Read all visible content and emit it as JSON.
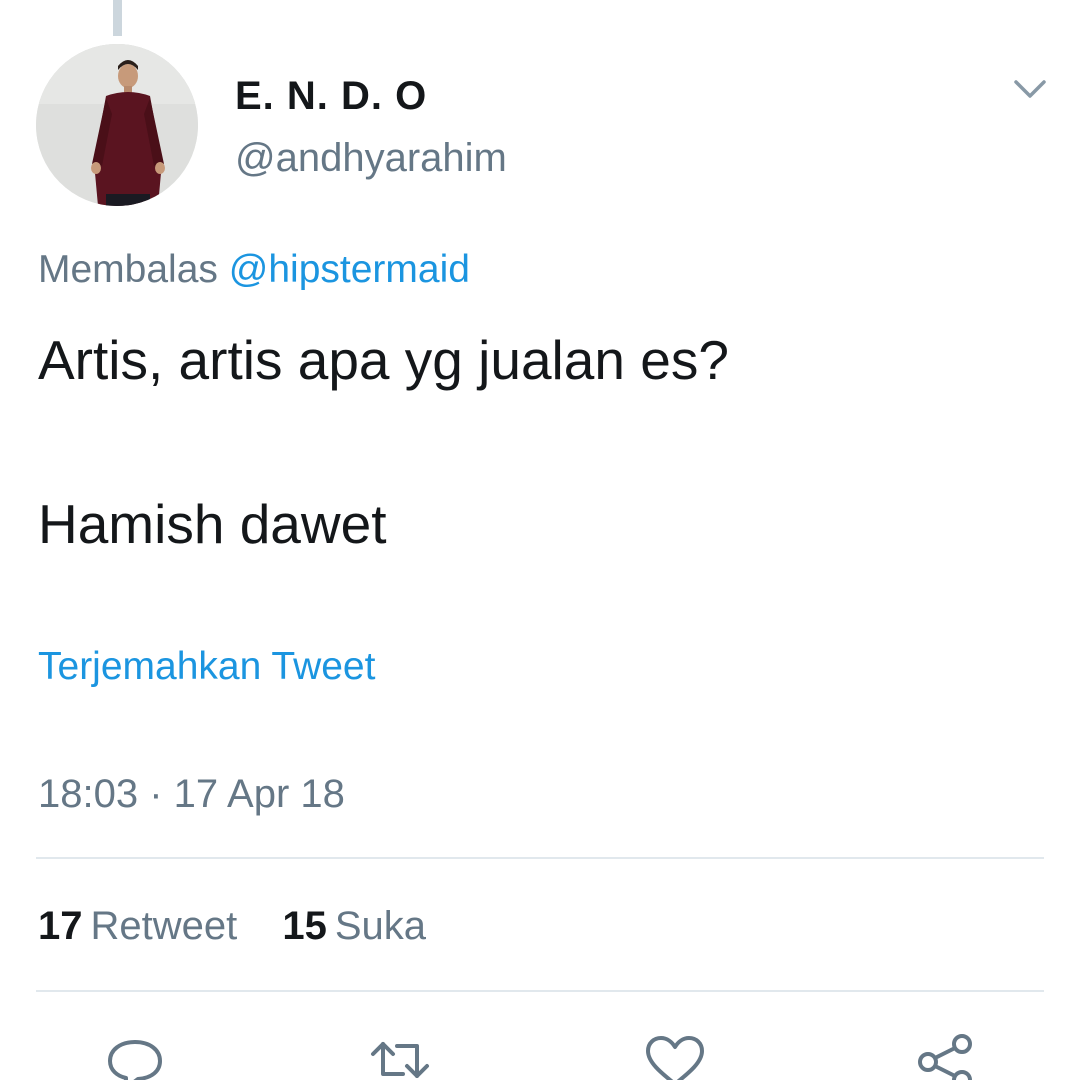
{
  "tweet": {
    "display_name": "E. N. D. O",
    "handle": "@andhyarahim",
    "reply_prefix": "Membalas",
    "reply_mention": "@hipstermaid",
    "text_line_1": "Artis, artis apa yg jualan es?",
    "text_line_2": "Hamish dawet",
    "translate_label": "Terjemahkan Tweet",
    "timestamp": "18:03 · 17 Apr 18"
  },
  "stats": {
    "retweet_count": "17",
    "retweet_label": "Retweet",
    "like_count": "15",
    "like_label": "Suka"
  },
  "icons": {
    "caret": "chevron-down-icon",
    "reply": "reply-icon",
    "retweet": "retweet-icon",
    "like": "heart-icon",
    "share": "share-icon"
  },
  "colors": {
    "text": "#14171a",
    "secondary": "#657786",
    "link": "#1b95e0",
    "divider": "#e1e8ed",
    "icon": "#657786"
  }
}
